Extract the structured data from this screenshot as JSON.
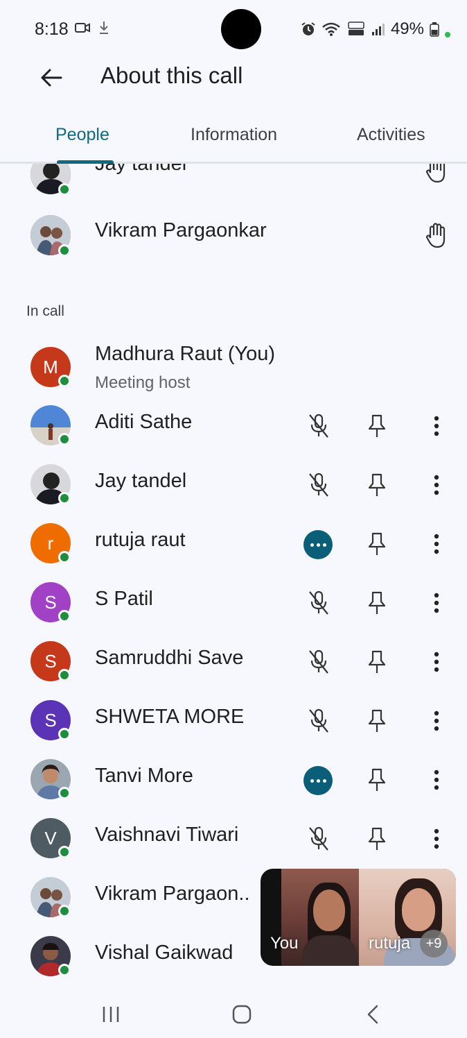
{
  "status_bar": {
    "time": "8:18",
    "battery": "49%"
  },
  "header": {
    "title": "About this call"
  },
  "tabs": [
    {
      "label": "People",
      "active": true
    },
    {
      "label": "Information",
      "active": false
    },
    {
      "label": "Activities",
      "active": false
    }
  ],
  "raised_hands": [
    {
      "name": "Jay tandel"
    },
    {
      "name": "Vikram Pargaonkar"
    }
  ],
  "in_call": {
    "label": "In call",
    "host": {
      "name": "Madhura Raut (You)",
      "initial": "M",
      "subtitle": "Meeting host",
      "color": "#c5391a"
    },
    "participants": [
      {
        "name": "Aditi Sathe",
        "initial": "",
        "color": "#5b87c7",
        "status": "muted"
      },
      {
        "name": "Jay tandel",
        "initial": "",
        "color": "#3a3a44",
        "status": "muted"
      },
      {
        "name": "rutuja raut",
        "initial": "r",
        "color": "#ef6c00",
        "status": "speaking"
      },
      {
        "name": "S Patil",
        "initial": "S",
        "color": "#a142c6",
        "status": "muted"
      },
      {
        "name": "Samruddhi Save",
        "initial": "S",
        "color": "#c5391a",
        "status": "muted"
      },
      {
        "name": "SHWETA MORE",
        "initial": "S",
        "color": "#5a33b7",
        "status": "muted"
      },
      {
        "name": "Tanvi More",
        "initial": "",
        "color": "#6f7e8a",
        "status": "speaking"
      },
      {
        "name": "Vaishnavi Tiwari",
        "initial": "V",
        "color": "#4f5b62",
        "status": "muted"
      },
      {
        "name": "Vikram Pargaon..",
        "initial": "",
        "color": "#7c8b9e",
        "status": "hidden"
      },
      {
        "name": "Vishal Gaikwad",
        "initial": "",
        "color": "#7a2b2b",
        "status": "hidden"
      }
    ]
  },
  "pip": {
    "self_label": "You",
    "other_label": "rutuja",
    "extra_count": "+9"
  }
}
